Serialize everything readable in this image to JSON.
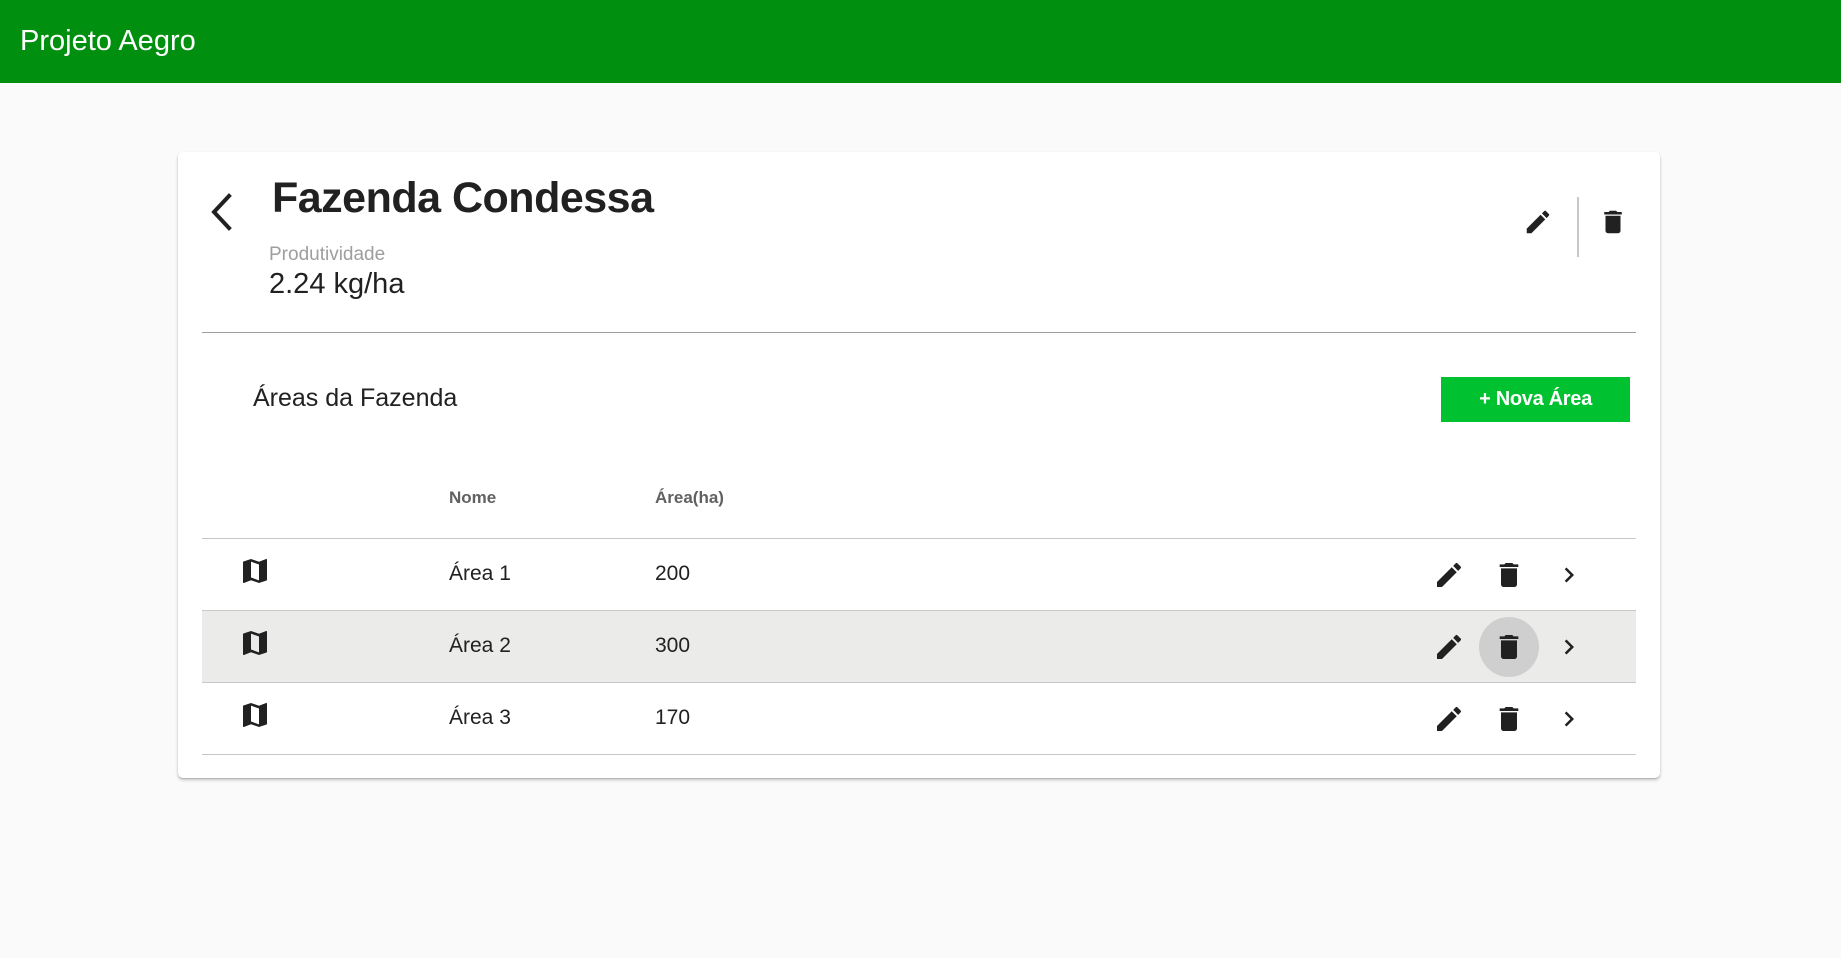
{
  "app": {
    "title": "Projeto Aegro"
  },
  "farm": {
    "name": "Fazenda Condessa",
    "productivity_label": "Produtividade",
    "productivity_value": "2.24 kg/ha"
  },
  "areas_section": {
    "title": "Áreas da Fazenda",
    "new_button_label": "+ Nova Área",
    "columns": [
      "Nome",
      "Área(ha)"
    ],
    "rows": [
      {
        "name": "Área 1",
        "area": "200"
      },
      {
        "name": "Área 2",
        "area": "300"
      },
      {
        "name": "Área 3",
        "area": "170"
      }
    ]
  },
  "colors": {
    "appbar": "#008f0e",
    "accent_button": "#00c12f",
    "row_highlight": "#ebebea"
  },
  "icons": {
    "back": "arrow-back-icon",
    "edit": "pencil-icon",
    "delete": "trash-icon",
    "row": "map-icon",
    "open": "chevron-right-icon"
  }
}
